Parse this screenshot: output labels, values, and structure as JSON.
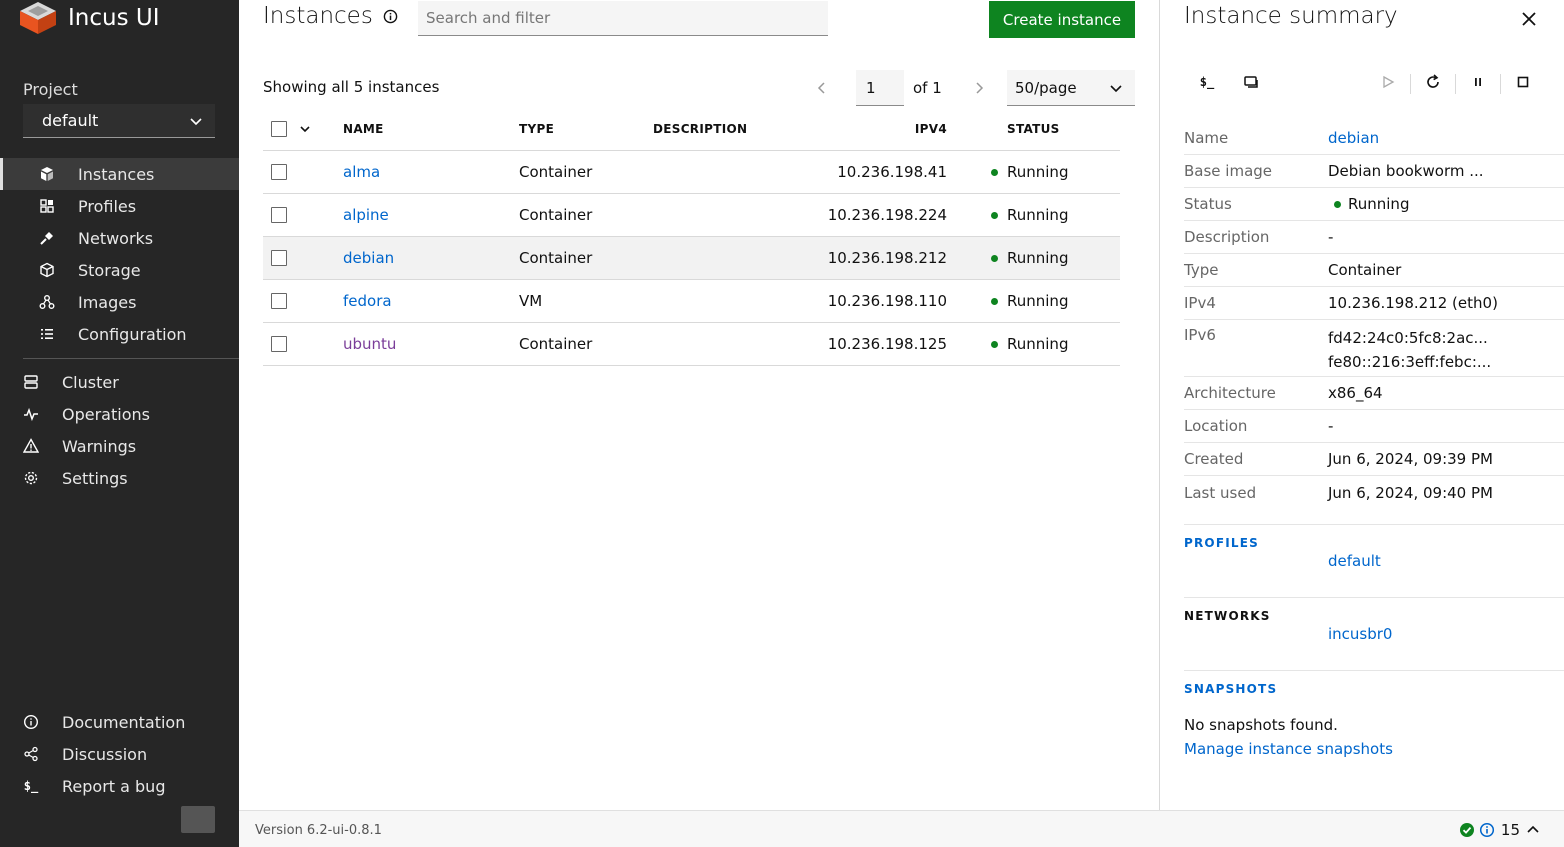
{
  "app": {
    "name": "Incus UI",
    "version": "Version 6.2-ui-0.8.1"
  },
  "sidebar": {
    "project_label": "Project",
    "project_value": "default",
    "project_items": [
      {
        "label": "Instances",
        "icon": "instances-icon",
        "active": true
      },
      {
        "label": "Profiles",
        "icon": "profiles-icon"
      },
      {
        "label": "Networks",
        "icon": "networks-icon"
      },
      {
        "label": "Storage",
        "icon": "storage-icon"
      },
      {
        "label": "Images",
        "icon": "images-icon"
      },
      {
        "label": "Configuration",
        "icon": "configuration-icon"
      }
    ],
    "global_items": [
      {
        "label": "Cluster",
        "icon": "cluster-icon"
      },
      {
        "label": "Operations",
        "icon": "operations-icon"
      },
      {
        "label": "Warnings",
        "icon": "warning-icon"
      },
      {
        "label": "Settings",
        "icon": "settings-icon"
      }
    ],
    "bottom_items": [
      {
        "label": "Documentation",
        "icon": "information-icon"
      },
      {
        "label": "Discussion",
        "icon": "share-icon"
      },
      {
        "label": "Report a bug",
        "icon": "terminal-icon"
      }
    ]
  },
  "main": {
    "title": "Instances",
    "search_placeholder": "Search and filter",
    "create_label": "Create instance",
    "showing": "Showing all 5 instances",
    "pager": {
      "page": "1",
      "of": "of 1",
      "per_page": "50/page"
    },
    "columns": {
      "name": "NAME",
      "type": "TYPE",
      "description": "DESCRIPTION",
      "ipv4": "IPV4",
      "status": "STATUS"
    },
    "rows": [
      {
        "name": "alma",
        "type": "Container",
        "description": "",
        "ipv4": "10.236.198.41",
        "status": "Running"
      },
      {
        "name": "alpine",
        "type": "Container",
        "description": "",
        "ipv4": "10.236.198.224",
        "status": "Running"
      },
      {
        "name": "debian",
        "type": "Container",
        "description": "",
        "ipv4": "10.236.198.212",
        "status": "Running"
      },
      {
        "name": "fedora",
        "type": "VM",
        "description": "",
        "ipv4": "10.236.198.110",
        "status": "Running"
      },
      {
        "name": "ubuntu",
        "type": "Container",
        "description": "",
        "ipv4": "10.236.198.125",
        "status": "Running"
      }
    ],
    "selected_row": 2
  },
  "summary": {
    "title": "Instance summary",
    "fields": {
      "name_key": "Name",
      "name_val": "debian",
      "base_key": "Base image",
      "base_val": "Debian bookworm ...",
      "status_key": "Status",
      "status_val": "Running",
      "desc_key": "Description",
      "desc_val": "-",
      "type_key": "Type",
      "type_val": "Container",
      "ipv4_key": "IPv4",
      "ipv4_val": "10.236.198.212 (eth0)",
      "ipv6_key": "IPv6",
      "ipv6_val1": "fd42:24c0:5fc8:2ac...",
      "ipv6_val2": "fe80::216:3eff:febc:...",
      "arch_key": "Architecture",
      "arch_val": "x86_64",
      "loc_key": "Location",
      "loc_val": "-",
      "created_key": "Created",
      "created_val": "Jun 6, 2024, 09:39 PM",
      "used_key": "Last used",
      "used_val": "Jun 6, 2024, 09:40 PM"
    },
    "profiles_head": "PROFILES",
    "profiles_val": "default",
    "networks_head": "NETWORKS",
    "networks_val": "incusbr0",
    "snapshots_head": "SNAPSHOTS",
    "snapshots_empty": "No snapshots found.",
    "snapshots_link": "Manage instance snapshots"
  },
  "footer": {
    "count": "15"
  },
  "colors": {
    "sidebar_bg": "#262626",
    "accent_green": "#0e8420",
    "link_blue": "#0066cc"
  }
}
